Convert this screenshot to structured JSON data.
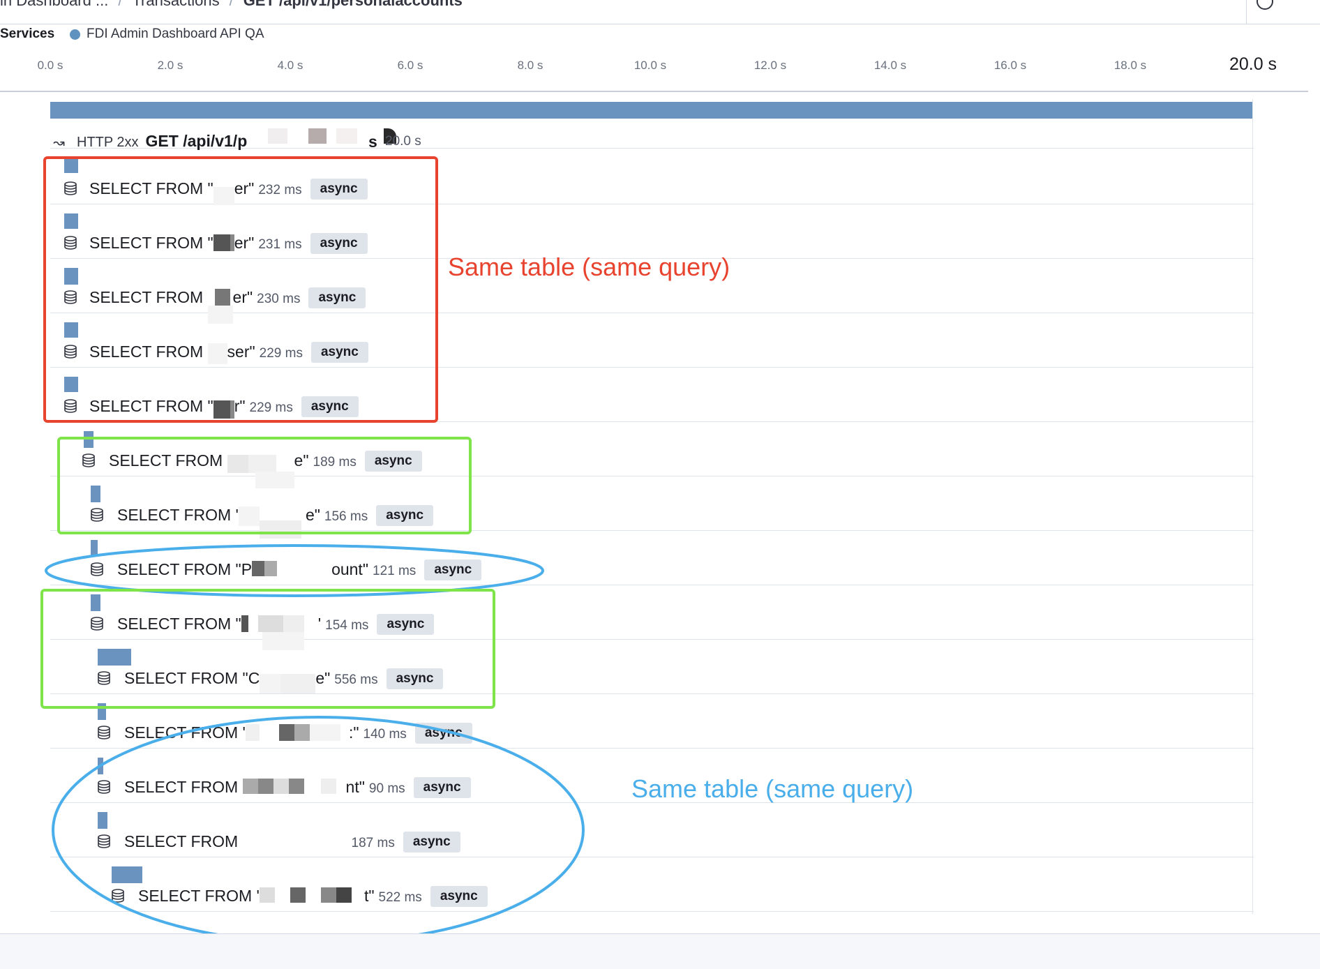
{
  "breadcrumbs": [
    {
      "label": "in Dashboard ..."
    },
    {
      "label": "Transactions"
    },
    {
      "label": "GET /api/v1/personalaccounts"
    }
  ],
  "services": {
    "label": "Services",
    "service_name": "FDI Admin Dashboard API QA",
    "service_color": "#6092c0"
  },
  "axis": {
    "ticks": [
      "0.0 s",
      "2.0 s",
      "4.0 s",
      "6.0 s",
      "8.0 s",
      "10.0 s",
      "12.0 s",
      "14.0 s",
      "16.0 s",
      "18.0 s",
      "20.0 s"
    ]
  },
  "transaction": {
    "status": "HTTP 2xx",
    "name": "GET /api/v1/p",
    "name_end": "s",
    "duration": "20.0 s"
  },
  "badge_label": "async",
  "spans": [
    {
      "prefix": "SELECT FROM \"",
      "suffix": "er\"",
      "duration": "232 ms"
    },
    {
      "prefix": "SELECT FROM \"",
      "suffix": "er\"",
      "duration": "231 ms"
    },
    {
      "prefix": "SELECT FROM ",
      "suffix": "er\"",
      "duration": "230 ms"
    },
    {
      "prefix": "SELECT FROM ",
      "suffix": "ser\"",
      "duration": "229 ms"
    },
    {
      "prefix": "SELECT FROM \"",
      "suffix": "r\"",
      "duration": "229 ms"
    },
    {
      "prefix": "SELECT FROM ",
      "suffix": "e\"",
      "duration": "189 ms"
    },
    {
      "prefix": "SELECT FROM '",
      "suffix": "e\"",
      "duration": "156 ms"
    },
    {
      "prefix": "SELECT FROM \"P",
      "suffix": "ount\"",
      "duration": "121 ms"
    },
    {
      "prefix": "SELECT FROM \"",
      "suffix": "'",
      "duration": "154 ms"
    },
    {
      "prefix": "SELECT FROM \"C",
      "suffix": "e\"",
      "duration": "556 ms"
    },
    {
      "prefix": "SELECT FROM '",
      "suffix": ":\"",
      "duration": "140 ms"
    },
    {
      "prefix": "SELECT FROM ",
      "suffix": "nt\"",
      "duration": "90 ms"
    },
    {
      "prefix": "SELECT FROM ",
      "suffix": "",
      "duration": "187 ms"
    },
    {
      "prefix": "SELECT FROM '",
      "suffix": "t\"",
      "duration": "522 ms"
    }
  ],
  "annotations": {
    "red": {
      "text": "Same table (same query)",
      "color": "#e8432e"
    },
    "green": {
      "color": "#7fe34a"
    },
    "blue": {
      "text": "Same table (same query)",
      "color": "#4aaeea"
    }
  }
}
